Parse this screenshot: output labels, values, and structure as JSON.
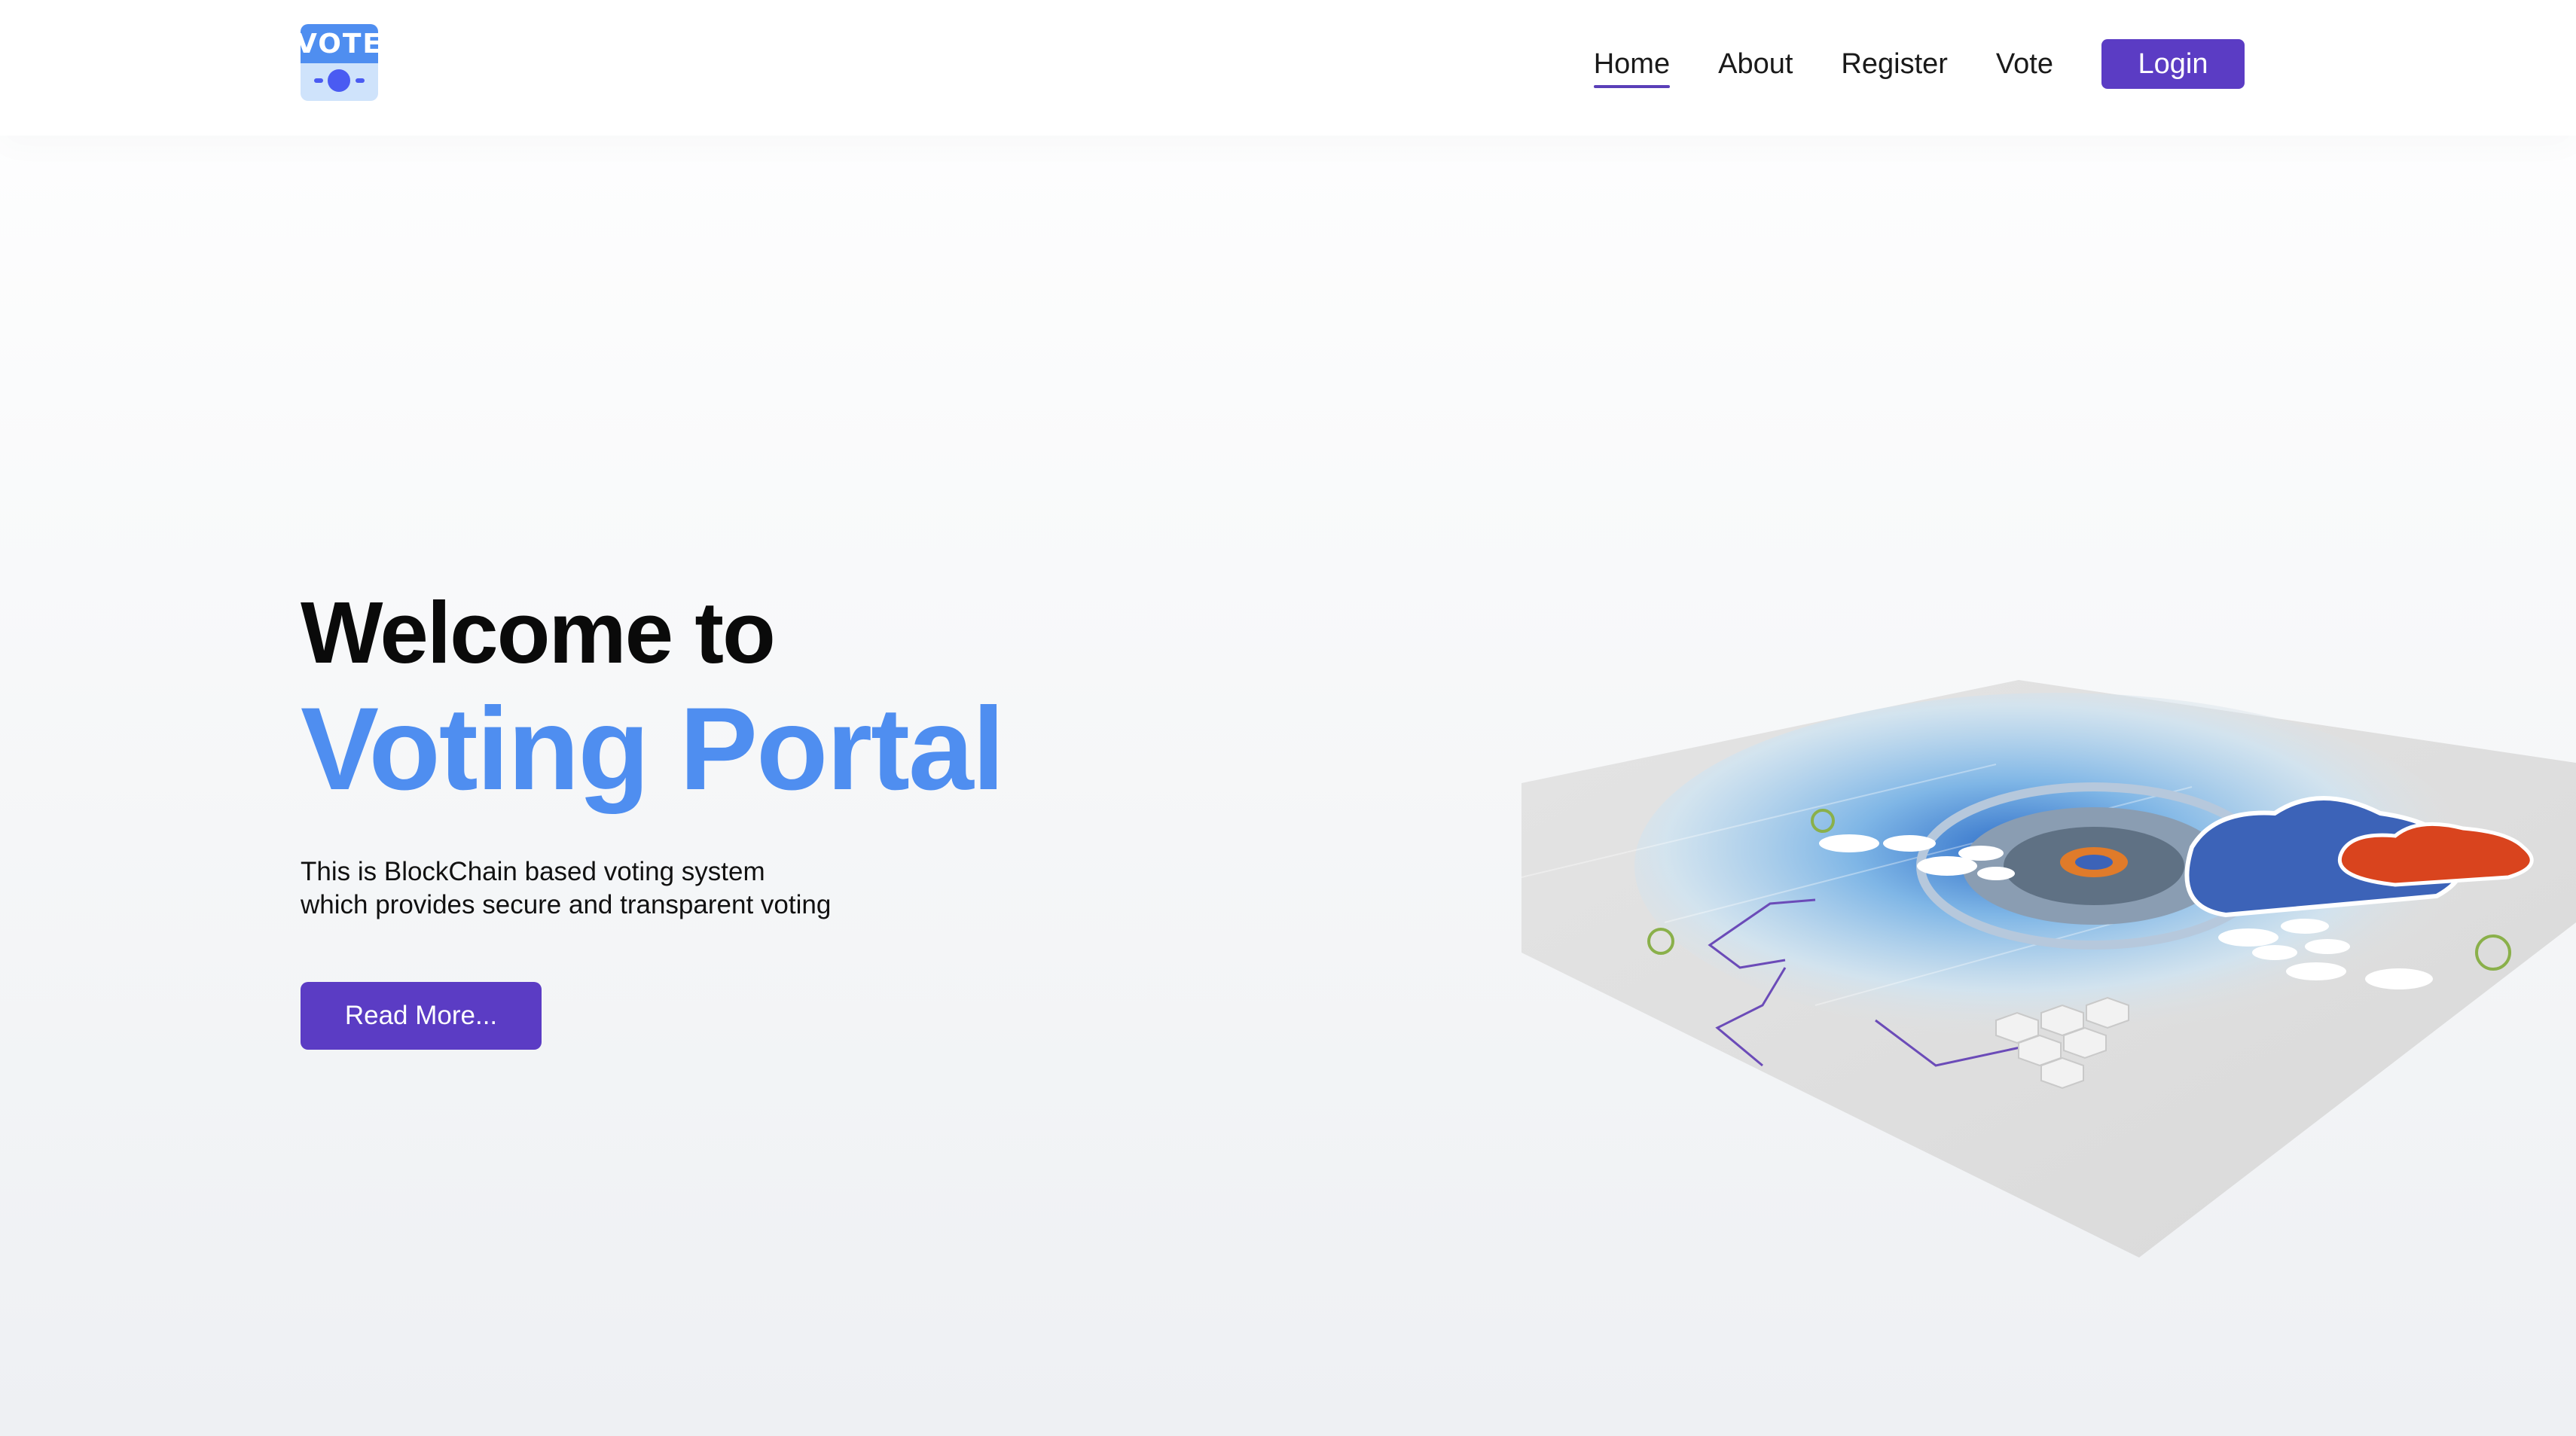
{
  "header": {
    "logo_text": "VOTE",
    "nav": [
      {
        "label": "Home",
        "active": true
      },
      {
        "label": "About",
        "active": false
      },
      {
        "label": "Register",
        "active": false
      },
      {
        "label": "Vote",
        "active": false
      }
    ],
    "login_label": "Login"
  },
  "hero": {
    "title": "Welcome to",
    "subtitle": "Voting Portal",
    "description_line1": "This is BlockChain based voting system",
    "description_line2": "which provides secure and transparent voting",
    "cta_label": "Read More..."
  },
  "colors": {
    "accent": "#5b3cc4",
    "brand_blue": "#4f8ef0",
    "cloud_red": "#d9441e",
    "cloud_blue": "#3c63b8"
  }
}
